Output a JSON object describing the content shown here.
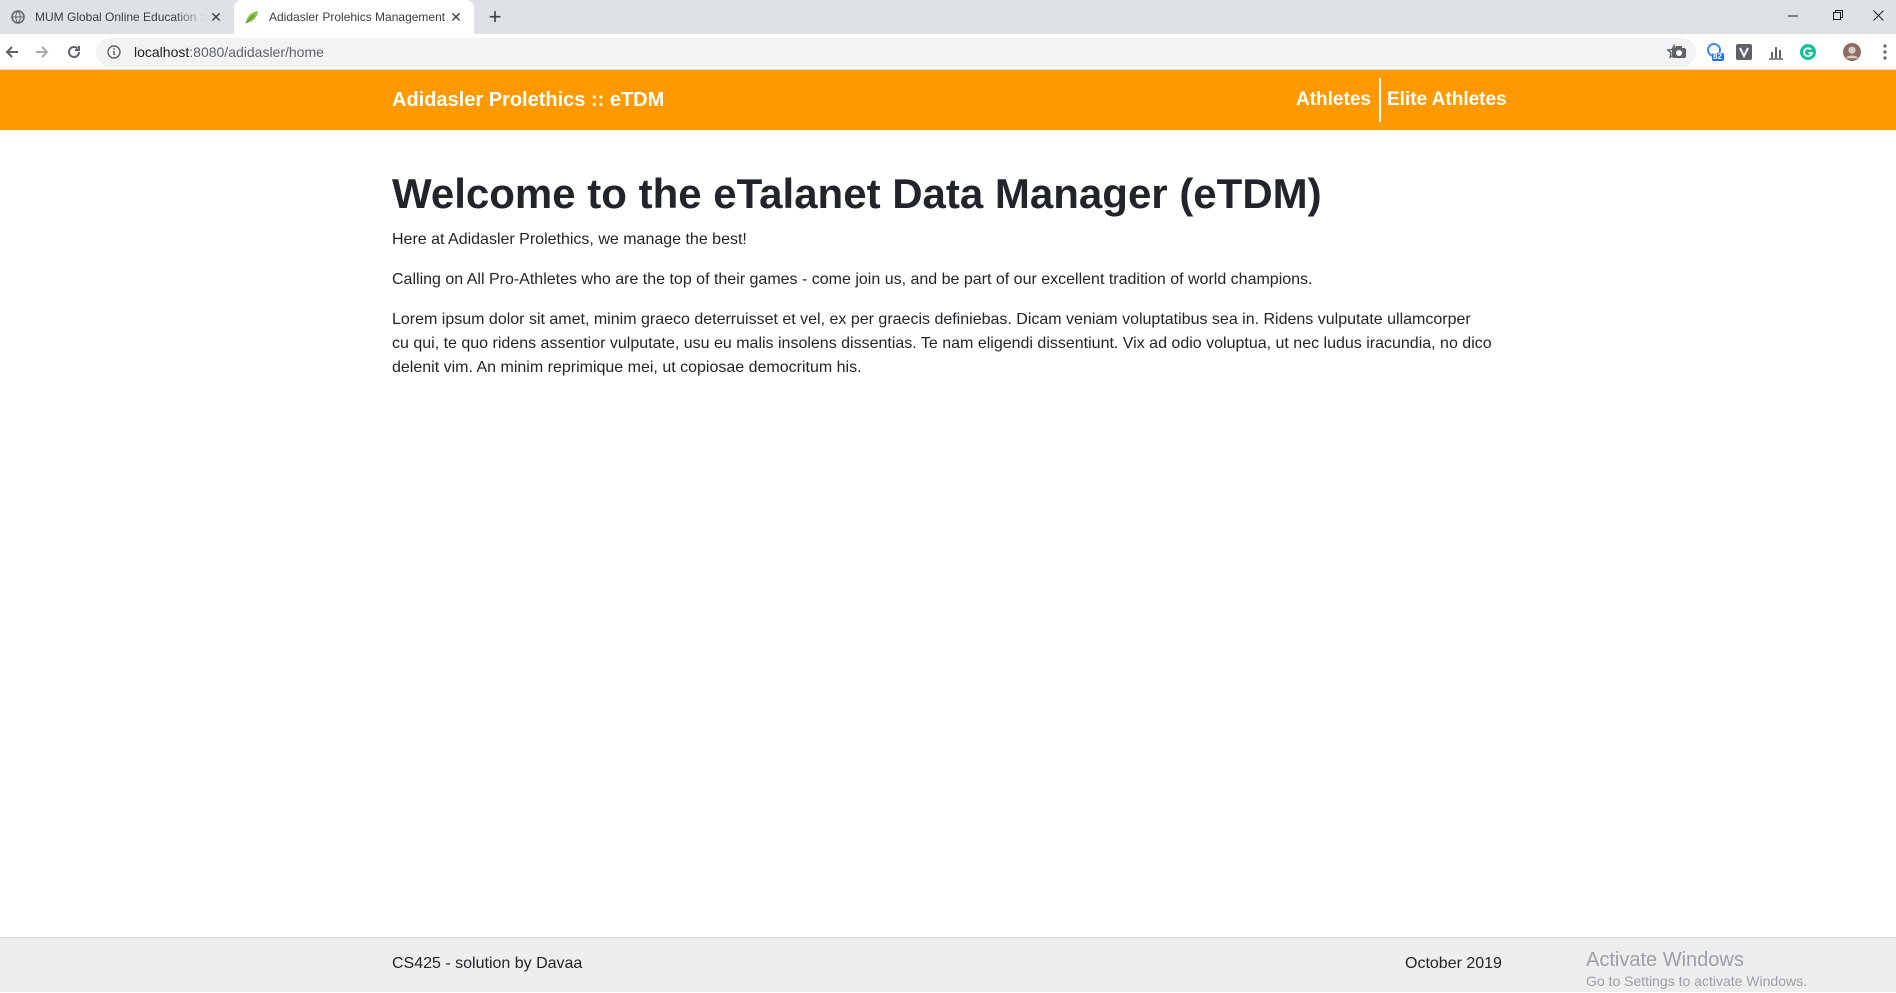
{
  "browser": {
    "tabs": [
      {
        "title": "MUM Global Online Education :: C",
        "favicon": "globe-icon",
        "active": false
      },
      {
        "title": "Adidasler Prolehics Management",
        "favicon": "leaf-icon",
        "active": true
      }
    ],
    "url_host": "localhost",
    "url_path": ":8080/adidasler/home",
    "extension_badge": "82"
  },
  "header": {
    "brand": "Adidasler Prolethics :: eTDM",
    "nav": [
      "Athletes",
      "Elite Athletes"
    ],
    "color": "#ff9900"
  },
  "main": {
    "heading": "Welcome to the eTalanet Data Manager (eTDM)",
    "paragraphs": [
      "Here at Adidasler Prolethics, we manage the best!",
      "Calling on All Pro-Athletes who are the top of their games - come join us, and be part of our excellent tradition of world champions.",
      "Lorem ipsum dolor sit amet, minim graeco deterruisset et vel, ex per graecis definiebas. Dicam veniam voluptatibus sea in. Ridens vulputate ullamcorper cu qui, te quo ridens assentior vulputate, usu eu malis insolens dissentias. Te nam eligendi dissentiunt. Vix ad odio voluptua, ut nec ludus iracundia, no dico delenit vim. An minim reprimique mei, ut copiosae democritum his."
    ]
  },
  "footer": {
    "left": "CS425 - solution by Davaa",
    "right": "October 2019",
    "background": "#eeeeee"
  },
  "watermark": {
    "line1": "Activate Windows",
    "line2": "Go to Settings to activate Windows."
  }
}
